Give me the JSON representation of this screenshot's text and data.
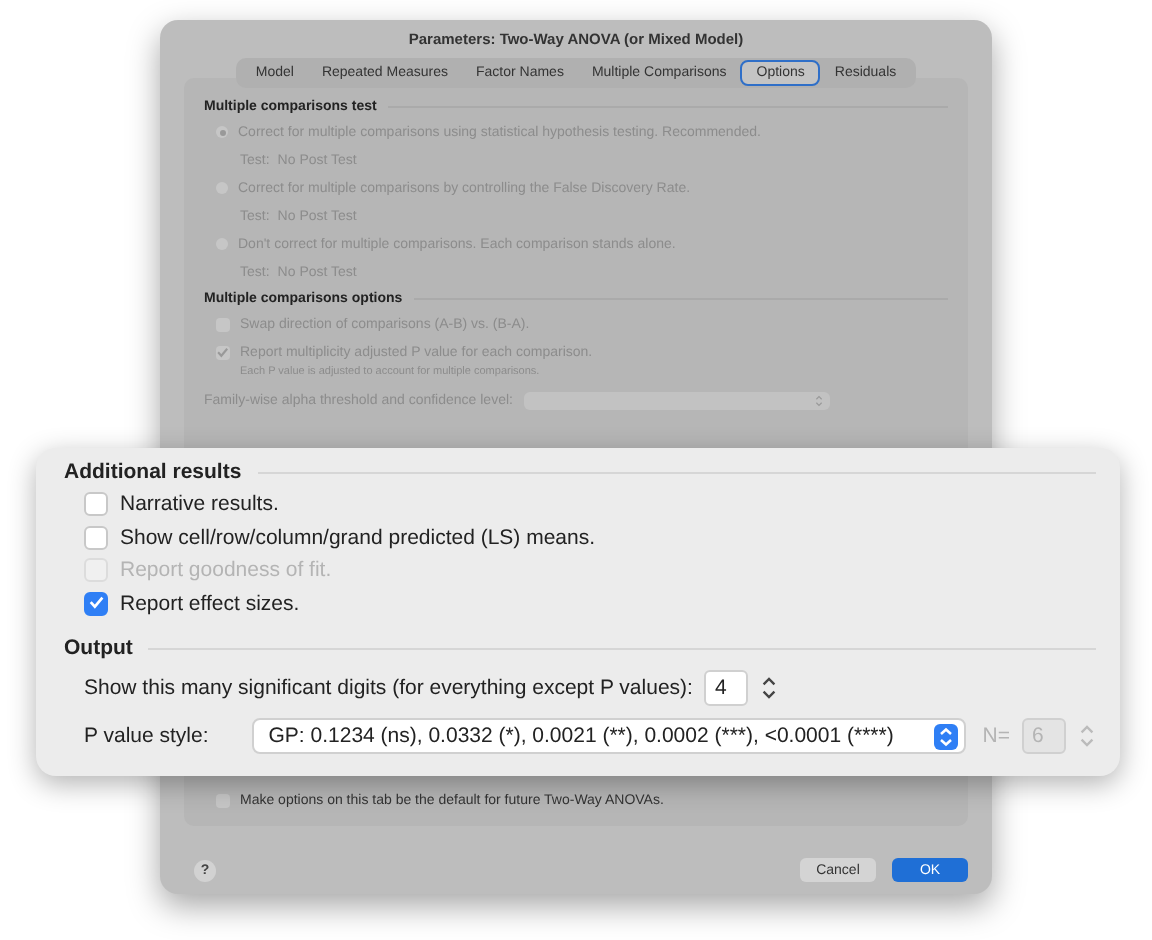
{
  "dialog": {
    "title": "Parameters: Two-Way ANOVA (or Mixed Model)",
    "tabs": [
      {
        "label": "Model",
        "selected": false
      },
      {
        "label": "Repeated Measures",
        "selected": false
      },
      {
        "label": "Factor Names",
        "selected": false
      },
      {
        "label": "Multiple Comparisons",
        "selected": false
      },
      {
        "label": "Options",
        "selected": true
      },
      {
        "label": "Residuals",
        "selected": false
      }
    ],
    "comparisons_test": {
      "heading": "Multiple comparisons test",
      "options": [
        {
          "label": "Correct for multiple comparisons using statistical hypothesis testing. Recommended.",
          "selected": true,
          "test_label": "Test:",
          "test_value": "No Post Test"
        },
        {
          "label": "Correct for multiple comparisons by controlling the False Discovery Rate.",
          "selected": false,
          "test_label": "Test:",
          "test_value": "No Post Test"
        },
        {
          "label": "Don't correct for multiple comparisons. Each comparison stands alone.",
          "selected": false,
          "test_label": "Test:",
          "test_value": "No Post Test"
        }
      ]
    },
    "comparisons_options": {
      "heading": "Multiple comparisons options",
      "items": [
        {
          "label": "Swap direction of comparisons (A-B) vs. (B-A).",
          "checked": false
        },
        {
          "label": "Report multiplicity adjusted P value for each comparison.",
          "checked": true,
          "note": "Each P value is adjusted to account for multiple comparisons."
        }
      ],
      "alpha_label": "Family-wise alpha threshold and confidence level:"
    },
    "default_option": {
      "label": "Make options on this tab be the default for future Two-Way ANOVAs.",
      "checked": false
    },
    "help_button": "?",
    "buttons": [
      {
        "label": "Cancel",
        "primary": false
      },
      {
        "label": "OK",
        "primary": true
      }
    ]
  },
  "callout": {
    "additional_results": {
      "heading": "Additional results",
      "items": [
        {
          "label": "Narrative results.",
          "checked": false,
          "disabled": false
        },
        {
          "label": "Show cell/row/column/grand predicted (LS) means.",
          "checked": false,
          "disabled": false
        },
        {
          "label": "Report goodness of fit.",
          "checked": false,
          "disabled": true
        },
        {
          "label": "Report effect sizes.",
          "checked": true,
          "disabled": false
        }
      ]
    },
    "output": {
      "heading": "Output",
      "digits_label": "Show this many significant digits (for everything except P values):",
      "digits_value": "4",
      "p_style_label": "P value style:",
      "p_style_value": "GP: 0.1234 (ns), 0.0332 (*), 0.0021 (**), 0.0002 (***), <0.0001 (****)",
      "n_label": "N=",
      "n_value": "6",
      "n_disabled": true
    }
  }
}
